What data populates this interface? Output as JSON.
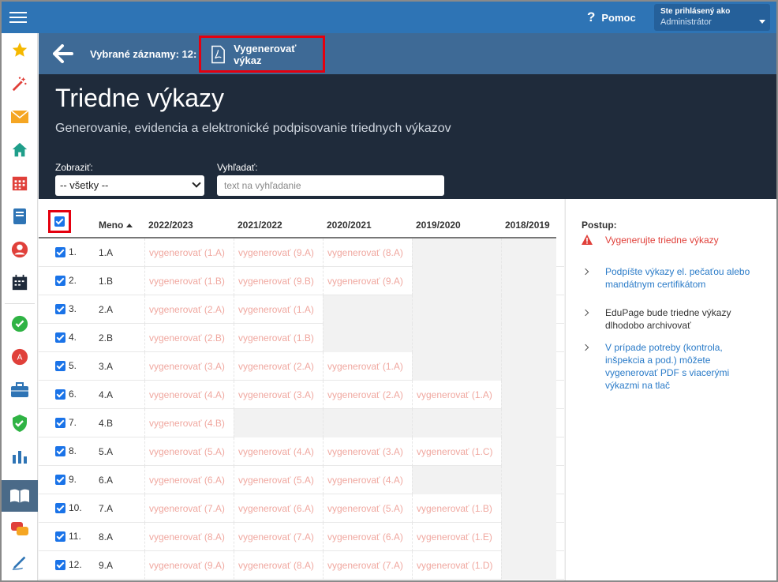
{
  "topbar": {
    "help_label": "Pomoc",
    "help_icon": "?",
    "user_label": "Ste prihlásený ako",
    "user_role": "Administrátor"
  },
  "sidebar": {
    "items": [
      "star-icon",
      "magic-wand-icon",
      "mail-icon",
      "home-icon",
      "calendar-icon",
      "notebook-icon",
      "user-icon",
      "timetable-icon",
      "check-icon",
      "grade-icon",
      "briefcase-icon",
      "shield-icon",
      "chart-icon",
      "book-icon",
      "chat-icon",
      "pen-icon"
    ]
  },
  "actionbar": {
    "selected_label": "Vybrané záznamy: 12:",
    "generate_label": "Vygenerovať výkaz"
  },
  "header": {
    "title": "Triedne výkazy",
    "subtitle": "Generovanie, evidencia a elektronické podpisovanie triednych výkazov",
    "show_label": "Zobraziť:",
    "show_value": "-- všetky --",
    "search_label": "Vyhľadať:",
    "search_placeholder": "text na vyhľadanie"
  },
  "table": {
    "columns": [
      "Meno",
      "2022/2023",
      "2021/2022",
      "2020/2021",
      "2019/2020",
      "2018/2019"
    ],
    "rows": [
      {
        "num": "1.",
        "name": "1.A",
        "cells": [
          "vygenerovať (1.A)",
          "vygenerovať (9.A)",
          "vygenerovať (8.A)",
          "",
          ""
        ]
      },
      {
        "num": "2.",
        "name": "1.B",
        "cells": [
          "vygenerovať (1.B)",
          "vygenerovať (9.B)",
          "vygenerovať (9.A)",
          "",
          ""
        ]
      },
      {
        "num": "3.",
        "name": "2.A",
        "cells": [
          "vygenerovať (2.A)",
          "vygenerovať (1.A)",
          "",
          "",
          ""
        ]
      },
      {
        "num": "4.",
        "name": "2.B",
        "cells": [
          "vygenerovať (2.B)",
          "vygenerovať (1.B)",
          "",
          "",
          ""
        ]
      },
      {
        "num": "5.",
        "name": "3.A",
        "cells": [
          "vygenerovať (3.A)",
          "vygenerovať (2.A)",
          "vygenerovať (1.A)",
          "",
          ""
        ]
      },
      {
        "num": "6.",
        "name": "4.A",
        "cells": [
          "vygenerovať (4.A)",
          "vygenerovať (3.A)",
          "vygenerovať (2.A)",
          "vygenerovať (1.A)",
          ""
        ]
      },
      {
        "num": "7.",
        "name": "4.B",
        "cells": [
          "vygenerovať (4.B)",
          "",
          "",
          "",
          ""
        ]
      },
      {
        "num": "8.",
        "name": "5.A",
        "cells": [
          "vygenerovať (5.A)",
          "vygenerovať (4.A)",
          "vygenerovať (3.A)",
          "vygenerovať (1.C)",
          ""
        ]
      },
      {
        "num": "9.",
        "name": "6.A",
        "cells": [
          "vygenerovať (6.A)",
          "vygenerovať (5.A)",
          "vygenerovať (4.A)",
          "",
          ""
        ]
      },
      {
        "num": "10.",
        "name": "7.A",
        "cells": [
          "vygenerovať (7.A)",
          "vygenerovať (6.A)",
          "vygenerovať (5.A)",
          "vygenerovať (1.B)",
          ""
        ]
      },
      {
        "num": "11.",
        "name": "8.A",
        "cells": [
          "vygenerovať (8.A)",
          "vygenerovať (7.A)",
          "vygenerovať (6.A)",
          "vygenerovať (1.E)",
          ""
        ]
      },
      {
        "num": "12.",
        "name": "9.A",
        "cells": [
          "vygenerovať (9.A)",
          "vygenerovať (8.A)",
          "vygenerovať (7.A)",
          "vygenerovať (1.D)",
          ""
        ]
      }
    ]
  },
  "panel": {
    "title": "Postup:",
    "steps": [
      {
        "text": "Vygenerujte triedne výkazy",
        "color": "#e0403a",
        "icon": "warning-icon"
      },
      {
        "text": "Podpíšte výkazy el. pečaťou alebo mandátnym certifikátom",
        "color": "#2a7bc8",
        "icon": "chevron-right-icon"
      },
      {
        "text": "EduPage bude triedne výkazy dlhodobo archivovať",
        "color": "#333333",
        "icon": "chevron-right-icon"
      },
      {
        "text": "V prípade potreby (kontrola, inšpekcia a pod.) môžete vygenerovať PDF s viacerými výkazmi na tlač",
        "color": "#2a7bc8",
        "icon": "chevron-right-icon"
      }
    ]
  },
  "colors": {
    "topbar": "#2e74b5",
    "actionbar": "#3e6a96",
    "header": "#1f2b3b",
    "highlight": "#e4000f",
    "link_pale": "#f0a8a0"
  }
}
